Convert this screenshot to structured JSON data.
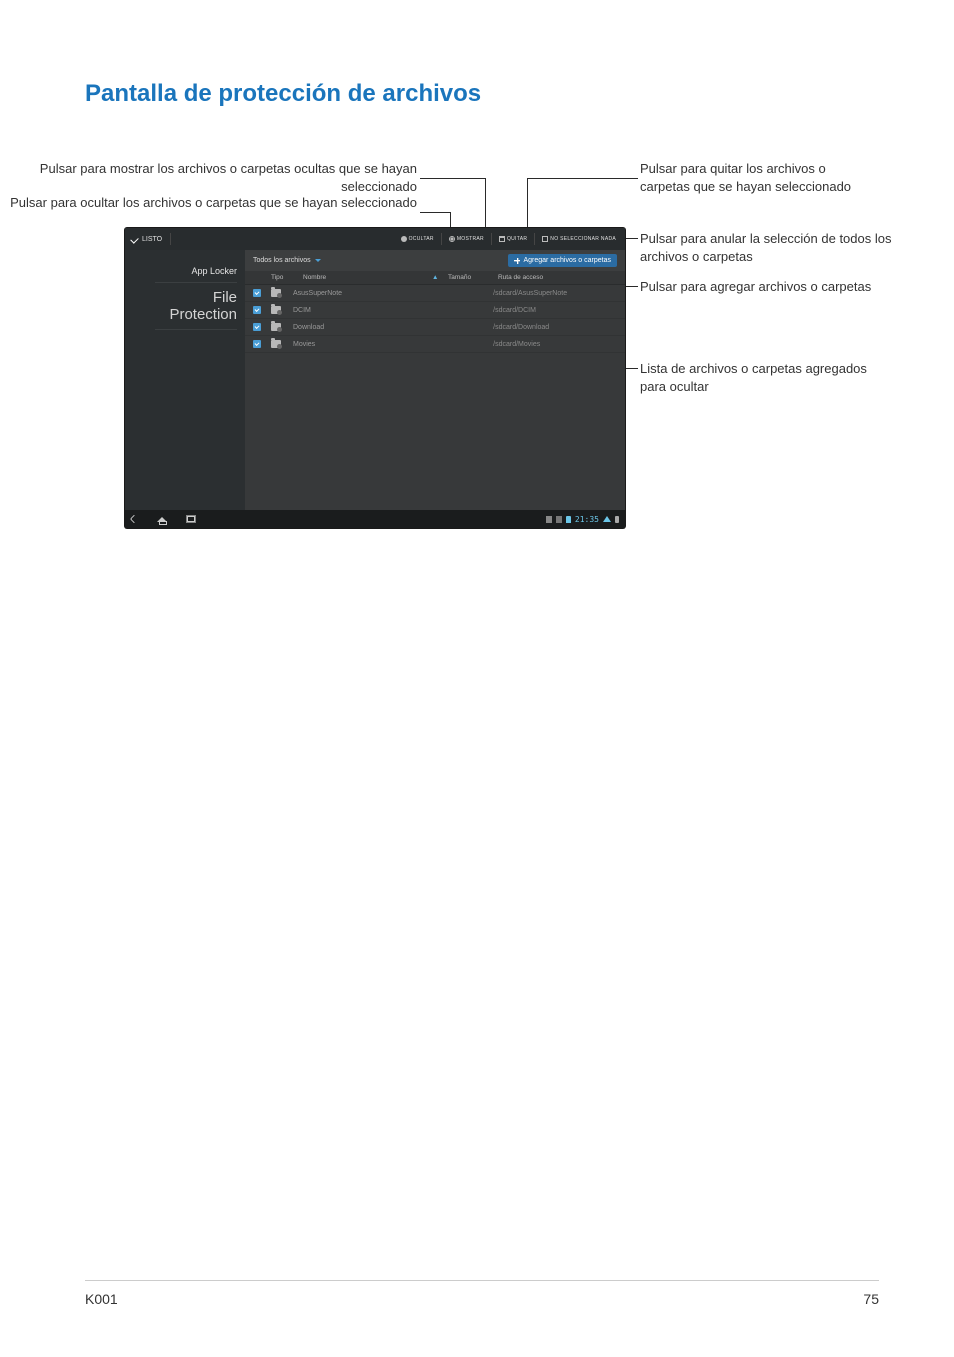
{
  "page": {
    "title": "Pantalla de protección de archivos",
    "footer_left": "K001",
    "footer_right": "75"
  },
  "callouts": {
    "show_hidden": "Pulsar para mostrar los archivos o carpetas ocultas que se hayan seleccionado",
    "hide_selected": "Pulsar para ocultar los archivos o carpetas que se hayan seleccionado",
    "remove": "Pulsar para quitar los archivos o carpetas que se hayan seleccionado",
    "deselect": "Pulsar para anular la selección de todos los archivos o carpetas",
    "add": "Pulsar para agregar archivos o carpetas",
    "list": "Lista de archivos o carpetas agregados para ocultar"
  },
  "screenshot": {
    "topbar": {
      "done": "LISTO",
      "hide": "OCULTAR",
      "show": "MOSTRAR",
      "remove": "QUITAR",
      "deselect": "NO SELECCIONAR NADA"
    },
    "sidebar": {
      "app_locker": "App Locker",
      "file_protection_1": "File",
      "file_protection_2": "Protection"
    },
    "content": {
      "dropdown": "Todos los archivos",
      "add_button": "Agregar archivos o carpetas",
      "headers": {
        "type": "Tipo",
        "name": "Nombre",
        "size": "Tamaño",
        "path": "Ruta de acceso"
      },
      "rows": [
        {
          "name": "AsusSuperNote",
          "path": "/sdcard/AsusSuperNote"
        },
        {
          "name": "DCIM",
          "path": "/sdcard/DCIM"
        },
        {
          "name": "Download",
          "path": "/sdcard/Download"
        },
        {
          "name": "Movies",
          "path": "/sdcard/Movies"
        }
      ]
    },
    "status": {
      "time": "21:35"
    }
  }
}
